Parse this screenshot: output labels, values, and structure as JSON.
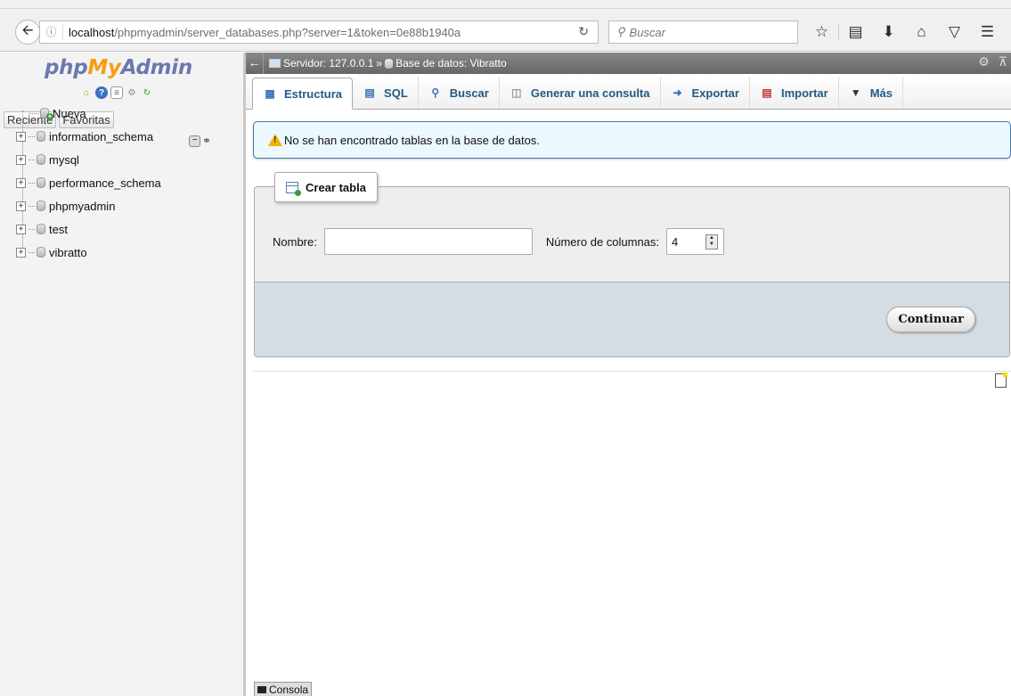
{
  "browser": {
    "url_host": "localhost",
    "url_path": "/phpmyadmin/server_databases.php?server=1&token=0e88b1940a",
    "search_placeholder": "Buscar"
  },
  "nav": {
    "logo_php": "php",
    "logo_my": "My",
    "logo_admin": "Admin",
    "tabs": [
      "Reciente",
      "Favoritas"
    ],
    "new_label": "Nueva",
    "databases": [
      "information_schema",
      "mysql",
      "performance_schema",
      "phpmyadmin",
      "test",
      "vibratto"
    ]
  },
  "breadcrumb": {
    "server": "Servidor: 127.0.0.1",
    "separator": "»",
    "database": "Base de datos: Vibratto"
  },
  "tabs": [
    {
      "label": "Estructura",
      "icon": "structure-icon"
    },
    {
      "label": "SQL",
      "icon": "sql-icon"
    },
    {
      "label": "Buscar",
      "icon": "search-icon"
    },
    {
      "label": "Generar una consulta",
      "icon": "query-icon"
    },
    {
      "label": "Exportar",
      "icon": "export-icon"
    },
    {
      "label": "Importar",
      "icon": "import-icon"
    },
    {
      "label": "Más",
      "icon": "more-icon"
    }
  ],
  "notice": {
    "text": "No se han encontrado tablas en la base de datos."
  },
  "create_table": {
    "legend": "Crear tabla",
    "name_label": "Nombre:",
    "name_value": "",
    "columns_label": "Número de columnas:",
    "columns_value": "4",
    "submit_label": "Continuar"
  },
  "console": {
    "label": "Consola"
  }
}
